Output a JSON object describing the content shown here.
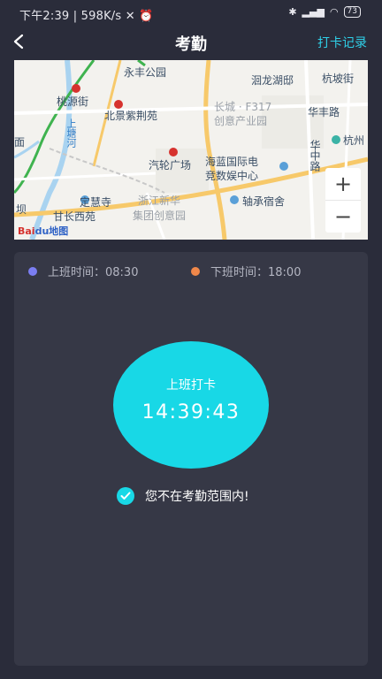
{
  "status_bar": {
    "time": "下午2:39",
    "network_speed": "598K/s",
    "battery": "73"
  },
  "header": {
    "title": "考勤",
    "record_link": "打卡记录"
  },
  "map": {
    "labels": {
      "yongfeng": "永丰公园",
      "taoyuan": "桃源街",
      "huilong": "洄龙湖邸",
      "hangpo": "杭坡街",
      "beijing": "北景紫荆苑",
      "changcheng1": "长城 · F317",
      "changcheng2": "创意产业园",
      "huafeng": "华丰路",
      "hang": "杭州",
      "shangtang": "上塘河",
      "qiche": "汽轮广场",
      "hailan1": "海蓝国际电",
      "hailan2": "竞数娱中心",
      "huazhong": "华中路",
      "dinghui": "定慧寺",
      "zhejiang": "浙江新华",
      "jituan": "集团创意园",
      "zhoucheng": "轴承宿舍",
      "ganchang": "甘长西苑",
      "ba": "坝",
      "mian": "面"
    },
    "zoom_in": "+",
    "zoom_out": "−",
    "logo_bai": "Bai",
    "logo_du": "du地图"
  },
  "panel": {
    "start_legend": "上班时间：08:30",
    "end_legend": "下班时间：18:00",
    "clock_label": "上班打卡",
    "clock_time": "14:39:43",
    "range_status": "您不在考勤范围内!",
    "colors": {
      "start_dot": "#7b7ef2",
      "end_dot": "#f0884a",
      "accent": "#18d8e6"
    }
  }
}
